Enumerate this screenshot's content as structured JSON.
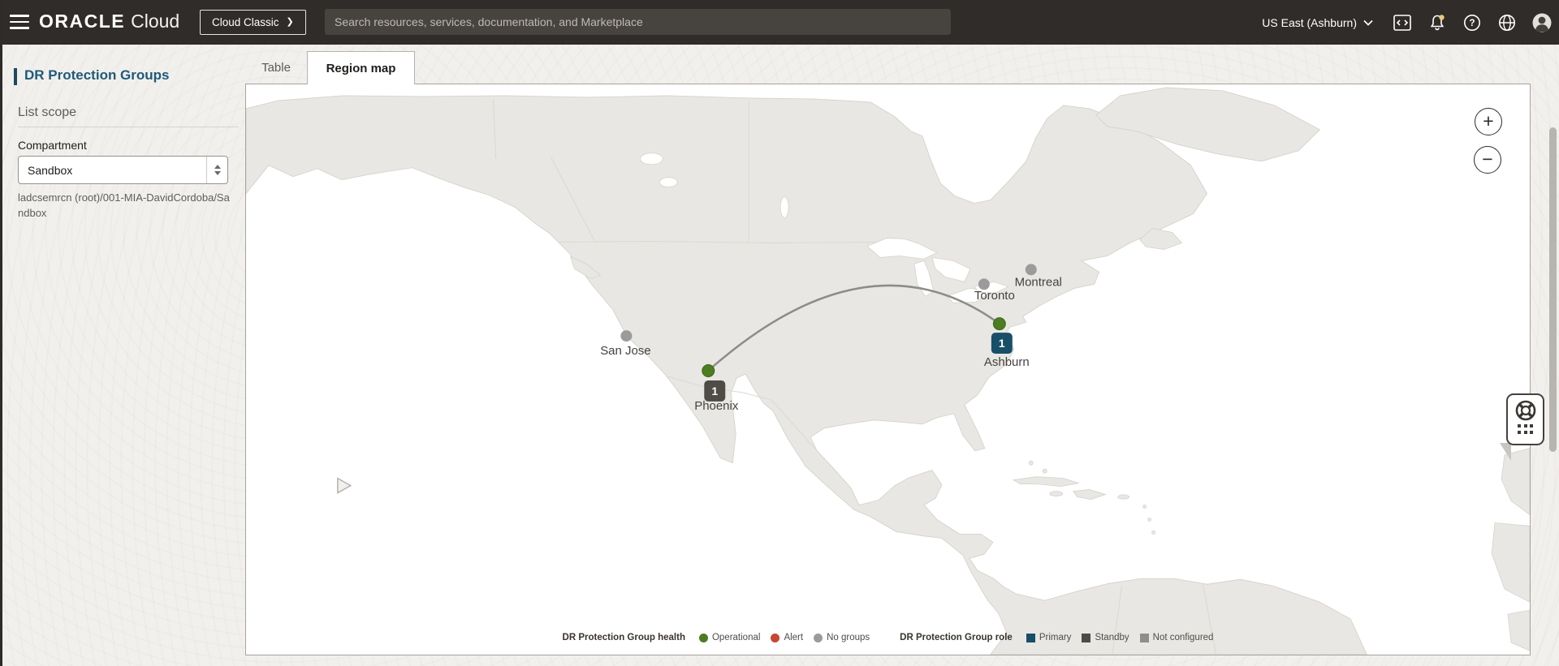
{
  "header": {
    "logo_brand": "ORACLE",
    "logo_product": "Cloud",
    "cloud_classic_label": "Cloud Classic",
    "cloud_classic_chevron": "❯",
    "search_placeholder": "Search resources, services, documentation, and Marketplace",
    "region_label": "US East (Ashburn)"
  },
  "page": {
    "title": "DR Protection Groups",
    "tab_table": "Table",
    "tab_region_map": "Region map"
  },
  "sidebar": {
    "list_scope_label": "List scope",
    "compartment_label": "Compartment",
    "compartment_value": "Sandbox",
    "compartment_path": "ladcsemrcn (root)/001-MIA-DavidCordoba/Sandbox"
  },
  "map": {
    "zoom_in_glyph": "+",
    "zoom_out_glyph": "−",
    "colors": {
      "operational": "#4c7d20",
      "alert": "#c74634",
      "no_groups": "#9b9b9b",
      "primary": "#174e68",
      "standby": "#4f4b45",
      "not_configured": "#908e8a",
      "connection_line": "#8c8c8c"
    },
    "cities": [
      {
        "name": "Montreal",
        "health": "no-groups"
      },
      {
        "name": "Toronto",
        "health": "no-groups"
      },
      {
        "name": "San Jose",
        "health": "no-groups"
      },
      {
        "name": "Ashburn",
        "health": "operational",
        "count": "1",
        "role": "primary"
      },
      {
        "name": "Phoenix",
        "health": "operational",
        "count": "1",
        "role": "standby"
      }
    ],
    "connection": {
      "from": "Phoenix",
      "to": "Ashburn"
    },
    "legend": {
      "health_title": "DR Protection Group health",
      "health_items": [
        {
          "label": "Operational",
          "color": "#4c7d20"
        },
        {
          "label": "Alert",
          "color": "#c74634"
        },
        {
          "label": "No groups",
          "color": "#9b9b9b"
        }
      ],
      "role_title": "DR Protection Group role",
      "role_items": [
        {
          "label": "Primary",
          "color": "#174e68"
        },
        {
          "label": "Standby",
          "color": "#4f4b45"
        },
        {
          "label": "Not configured",
          "color": "#908e8a"
        }
      ]
    }
  }
}
